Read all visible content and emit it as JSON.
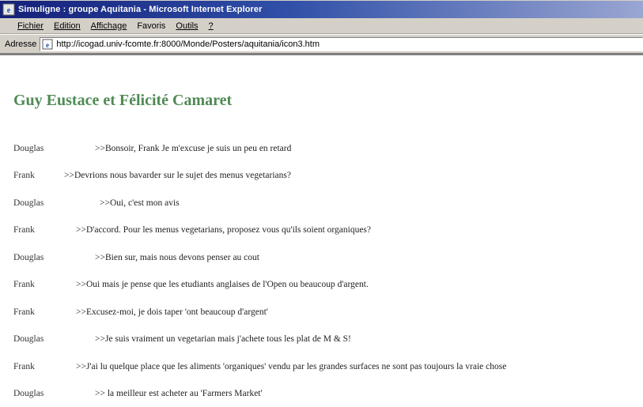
{
  "window": {
    "title": "Simuligne : groupe Aquitania - Microsoft Internet Explorer"
  },
  "menu": {
    "items": [
      {
        "label": "Fichier"
      },
      {
        "label": "Edition"
      },
      {
        "label": "Affichage"
      },
      {
        "label": "Favoris"
      },
      {
        "label": "Outils"
      },
      {
        "label": "?"
      }
    ]
  },
  "address": {
    "label": "Adresse",
    "url": "http://icogad.univ-fcomte.fr:8000/Monde/Posters/aquitania/icon3.htm"
  },
  "page": {
    "title": "Guy Eustace et Félicité Camaret"
  },
  "chat": [
    {
      "speaker": "Douglas",
      "message": ">>Bonsoir, Frank Je m'excuse je suis un peu en retard"
    },
    {
      "speaker": "Frank",
      "message": ">>Devrions nous bavarder sur le sujet des menus vegetarians?"
    },
    {
      "speaker": "Douglas",
      "message": ">>Oui, c'est mon avis"
    },
    {
      "speaker": "Frank",
      "message": ">>D'accord. Pour les menus vegetarians, proposez vous qu'ils soient organiques?"
    },
    {
      "speaker": "Douglas",
      "message": ">>Bien sur, mais nous devons penser au cout"
    },
    {
      "speaker": "Frank",
      "message": ">>Oui mais je pense que les etudiants anglaises de l'Open ou beaucoup d'argent."
    },
    {
      "speaker": "Frank",
      "message": ">>Excusez-moi, je dois taper 'ont beaucoup d'argent'"
    },
    {
      "speaker": "Douglas",
      "message": ">>Je suis vraiment un vegetarian mais j'achete tous les plat de M & S!"
    },
    {
      "speaker": "Frank",
      "message": ">>J'ai lu quelque place que les aliments 'organiques' vendu par les grandes surfaces ne sont pas toujours la vraie chose"
    },
    {
      "speaker": "Douglas",
      "message": ">> la meilleur est acheter au 'Farmers Market'"
    }
  ],
  "colors": {
    "title_green": "#4f8a55",
    "titlebar_start": "#14207a",
    "titlebar_end": "#9aa6d2"
  },
  "icons": {
    "app": "internet-explorer-icon",
    "page": "page-icon"
  }
}
